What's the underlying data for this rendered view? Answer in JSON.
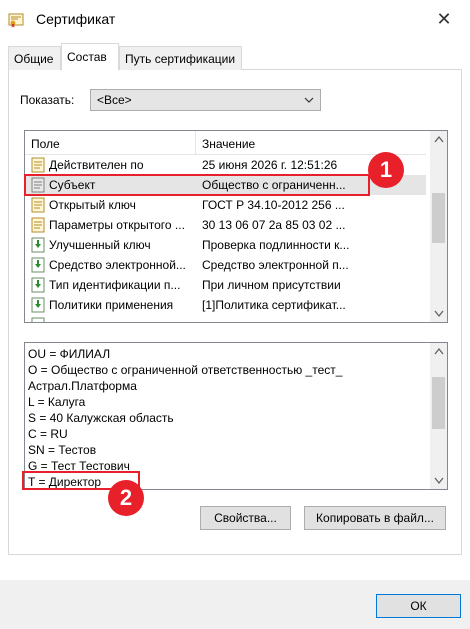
{
  "window": {
    "title": "Сертификат",
    "close_glyph": "✕"
  },
  "tabs": [
    {
      "label": "Общие"
    },
    {
      "label": "Состав"
    },
    {
      "label": "Путь сертификации"
    }
  ],
  "show": {
    "label": "Показать:",
    "value": "<Все>"
  },
  "list": {
    "col_field": "Поле",
    "col_value": "Значение",
    "rows": [
      {
        "field": "Действителен по",
        "value": "25 июня 2026 г. 12:51:26",
        "icon": "property-icon"
      },
      {
        "field": "Субъект",
        "value": "Общество с ограниченн...",
        "icon": "property-icon"
      },
      {
        "field": "Открытый ключ",
        "value": "ГОСТ Р 34.10-2012 256 ...",
        "icon": "property-icon"
      },
      {
        "field": "Параметры открытого ...",
        "value": "30 13 06 07 2a 85 03 02 ...",
        "icon": "property-icon"
      },
      {
        "field": "Улучшенный ключ",
        "value": "Проверка подлинности к...",
        "icon": "extension-icon"
      },
      {
        "field": "Средство электронной...",
        "value": "Средство электронной п...",
        "icon": "extension-icon"
      },
      {
        "field": "Тип идентификации п...",
        "value": "При личном присутствии",
        "icon": "extension-icon"
      },
      {
        "field": "Политики применения",
        "value": "[1]Политика сертификат...",
        "icon": "extension-icon"
      }
    ]
  },
  "detail": {
    "lines": [
      "OU = ФИЛИАЛ",
      "O = Общество с ограниченной ответственностью _тест_",
      "Астрал.Платформа",
      "L = Калуга",
      "S = 40 Калужская область",
      "C = RU",
      "SN = Тестов",
      "G = Тест Тестович",
      "T = Директор"
    ]
  },
  "buttons": {
    "properties": "Свойства...",
    "copy": "Копировать в файл...",
    "ok": "ОК"
  },
  "annotations": {
    "one": "1",
    "two": "2",
    "color": "#e8202a"
  }
}
